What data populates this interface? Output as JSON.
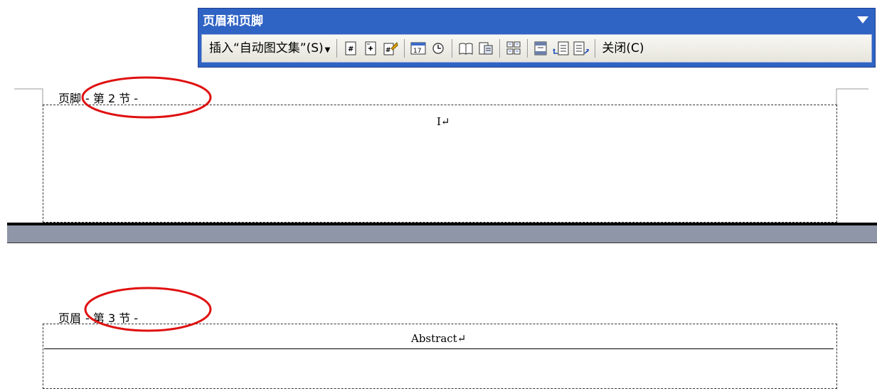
{
  "toolbar": {
    "title": "页眉和页脚",
    "insert_autotext_label": "插入“自动图文集”(S)",
    "close_label": "关闭(C)",
    "buttons": [
      {
        "icon": "insert-page-number-icon"
      },
      {
        "icon": "insert-page-count-icon"
      },
      {
        "icon": "format-page-number-icon"
      },
      {
        "icon": "insert-date-icon"
      },
      {
        "icon": "insert-time-icon"
      },
      {
        "icon": "page-setup-icon"
      },
      {
        "icon": "show-hide-document-text-icon"
      },
      {
        "icon": "link-to-previous-icon"
      },
      {
        "icon": "switch-header-footer-icon"
      },
      {
        "icon": "show-previous-icon"
      },
      {
        "icon": "show-next-icon"
      }
    ]
  },
  "footer_section": {
    "label": "页脚",
    "section": "- 第 2 节 -",
    "content": "I↵"
  },
  "header_section": {
    "label": "页眉",
    "section": "- 第 3 节 -",
    "content": "Abstract↵"
  },
  "colors": {
    "toolbar_blue": "#2f63c4",
    "highlight_red": "#e01010",
    "page_gap": "#8f96a8"
  }
}
